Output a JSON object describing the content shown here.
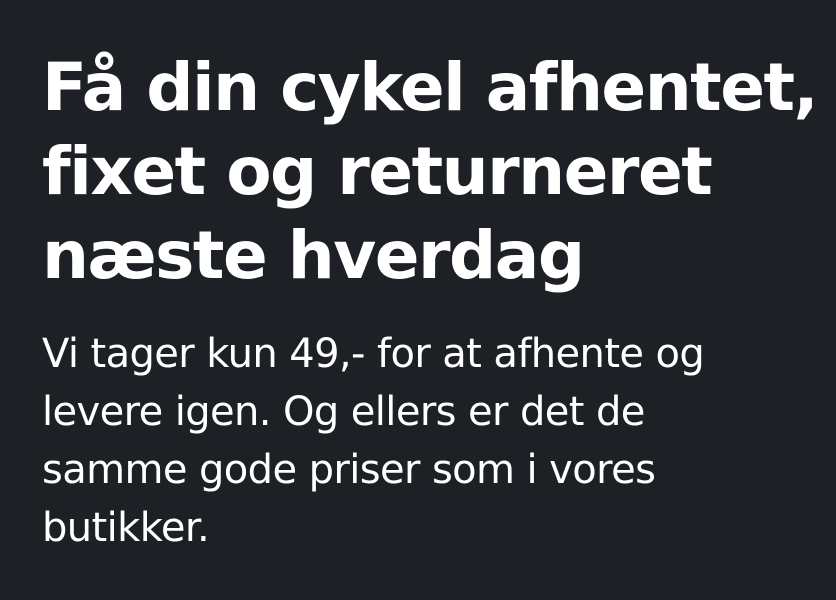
{
  "hero": {
    "headline_lines": [
      "Få din cykel afhentet,",
      "fixet og returneret",
      "næste hverdag"
    ],
    "subtext_lines": [
      "Vi tager kun 49,- for at afhente og",
      "levere igen. Og ellers er det de",
      "samme gode priser som i vores",
      "butikker."
    ]
  },
  "colors": {
    "background": "#1d2024",
    "text": "#ffffff"
  }
}
